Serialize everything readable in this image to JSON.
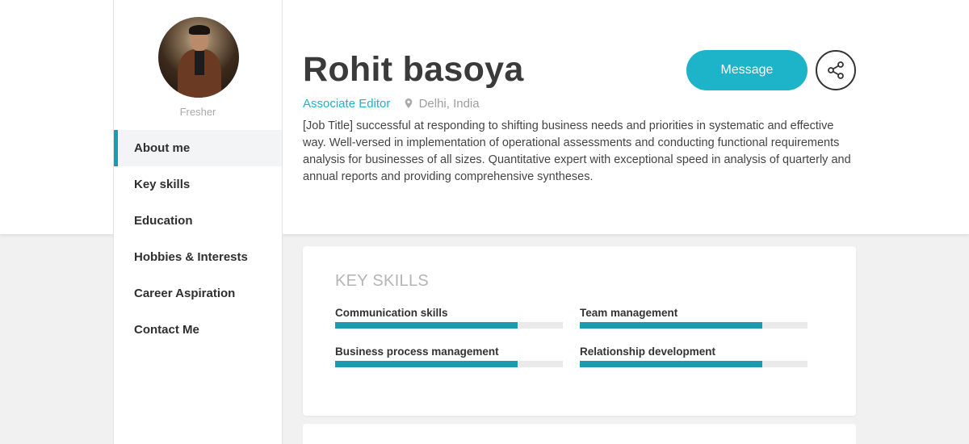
{
  "profile": {
    "name": "Rohit basoya",
    "role_label": "Fresher",
    "job_title": "Associate Editor",
    "location": "Delhi, India",
    "summary": "[Job Title] successful at responding to shifting business needs and priorities in systematic and effective way. Well-versed in implementation of operational assessments and conducting functional requirements analysis for businesses of all sizes. Quantitative expert with exceptional speed in analysis of quarterly and annual reports and providing comprehensive syntheses."
  },
  "actions": {
    "message_label": "Message",
    "share_icon": "share-icon"
  },
  "sidebar": {
    "items": [
      {
        "label": "About me",
        "active": true
      },
      {
        "label": "Key skills",
        "active": false
      },
      {
        "label": "Education",
        "active": false
      },
      {
        "label": "Hobbies & Interests",
        "active": false
      },
      {
        "label": "Career Aspiration",
        "active": false
      },
      {
        "label": "Contact Me",
        "active": false
      }
    ]
  },
  "key_skills": {
    "title": "KEY SKILLS",
    "skills": [
      {
        "name": "Communication skills",
        "level": 0.8
      },
      {
        "name": "Team management",
        "level": 0.8
      },
      {
        "name": "Business process management",
        "level": 0.8
      },
      {
        "name": "Relationship development",
        "level": 0.8
      }
    ]
  },
  "colors": {
    "accent": "#1db3c8",
    "bar": "#1a9cb0"
  }
}
